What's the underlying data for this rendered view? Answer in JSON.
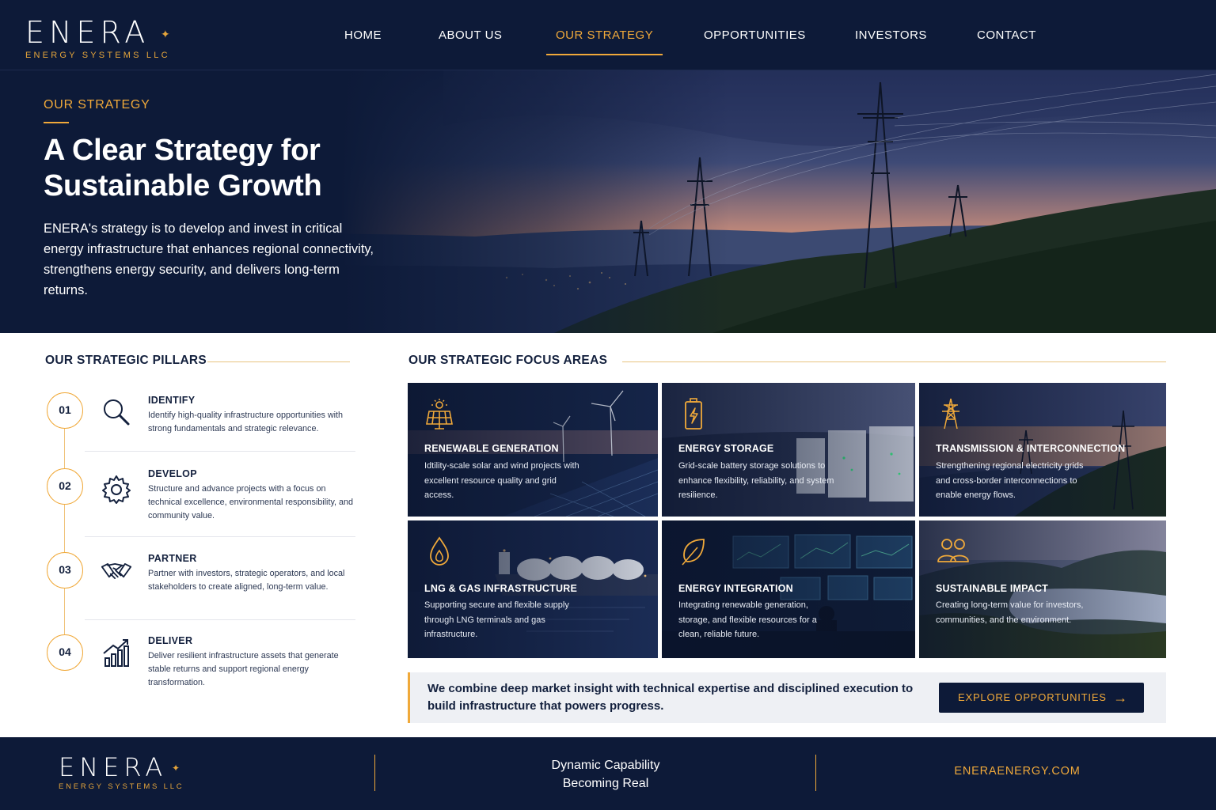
{
  "brand": {
    "name": "ENERA",
    "subtitle": "ENERGY SYSTEMS LLC"
  },
  "nav": {
    "items": [
      "HOME",
      "ABOUT US",
      "OUR STRATEGY",
      "OPPORTUNITIES",
      "INVESTORS",
      "CONTACT"
    ],
    "active": "OUR STRATEGY"
  },
  "hero": {
    "eyebrow": "OUR STRATEGY",
    "title": "A Clear Strategy for Sustainable Growth",
    "body": "ENERA's strategy is to develop and invest in critical energy infrastructure that enhances regional connectivity, strengthens energy security, and delivers long-term returns."
  },
  "pillars": {
    "title": "OUR STRATEGIC PILLARS",
    "items": [
      {
        "num": "01",
        "title": "IDENTIFY",
        "icon": "magnifier-icon",
        "desc": "Identify high-quality infrastructure opportunities with strong fundamentals and strategic relevance."
      },
      {
        "num": "02",
        "title": "DEVELOP",
        "icon": "gear-icon",
        "desc": "Structure and advance projects with a focus on technical excellence, environmental responsibility, and community value."
      },
      {
        "num": "03",
        "title": "PARTNER",
        "icon": "handshake-icon",
        "desc": "Partner with investors, strategic operators, and local stakeholders to create aligned, long-term value."
      },
      {
        "num": "04",
        "title": "DELIVER",
        "icon": "growth-chart-icon",
        "desc": "Deliver resilient infrastructure assets that generate stable returns and support regional energy transformation."
      }
    ]
  },
  "focus": {
    "title": "OUR STRATEGIC FOCUS AREAS",
    "cards": [
      {
        "title": "RENEWABLE GENERATION",
        "icon": "solar-panel-icon",
        "desc": "Idtility-scale solar and wind projects with excellent resource quality and grid access."
      },
      {
        "title": "ENERGY STORAGE",
        "icon": "battery-icon",
        "desc": "Grid-scale battery storage solutions to enhance flexibility, reliability, and system resilience."
      },
      {
        "title": "TRANSMISSION & INTERCONNECTION",
        "icon": "power-tower-icon",
        "desc": "Strengthening regional electricity grids and cross-border interconnections to enable energy flows."
      },
      {
        "title": "LNG & GAS INFRASTRUCTURE",
        "icon": "flame-drop-icon",
        "desc": "Supporting secure and flexible supply through LNG terminals and gas infrastructure."
      },
      {
        "title": "ENERGY INTEGRATION",
        "icon": "leaf-icon",
        "desc": "Integrating renewable generation, storage, and flexible resources for a clean, reliable future."
      },
      {
        "title": "SUSTAINABLE IMPACT",
        "icon": "people-icon",
        "desc": "Creating long-term value for investors, communities, and the environment."
      }
    ]
  },
  "cta": {
    "text": "We combine deep market insight with technical expertise and disciplined execution to build infrastructure that powers progress.",
    "button": "EXPLORE OPPORTUNITIES"
  },
  "footer": {
    "tagline_1": "Dynamic Capability",
    "tagline_2": "Becoming Real",
    "url": "ENERAENERGY.COM"
  },
  "colors": {
    "navy": "#0d1a38",
    "accent": "#f0a93a"
  }
}
